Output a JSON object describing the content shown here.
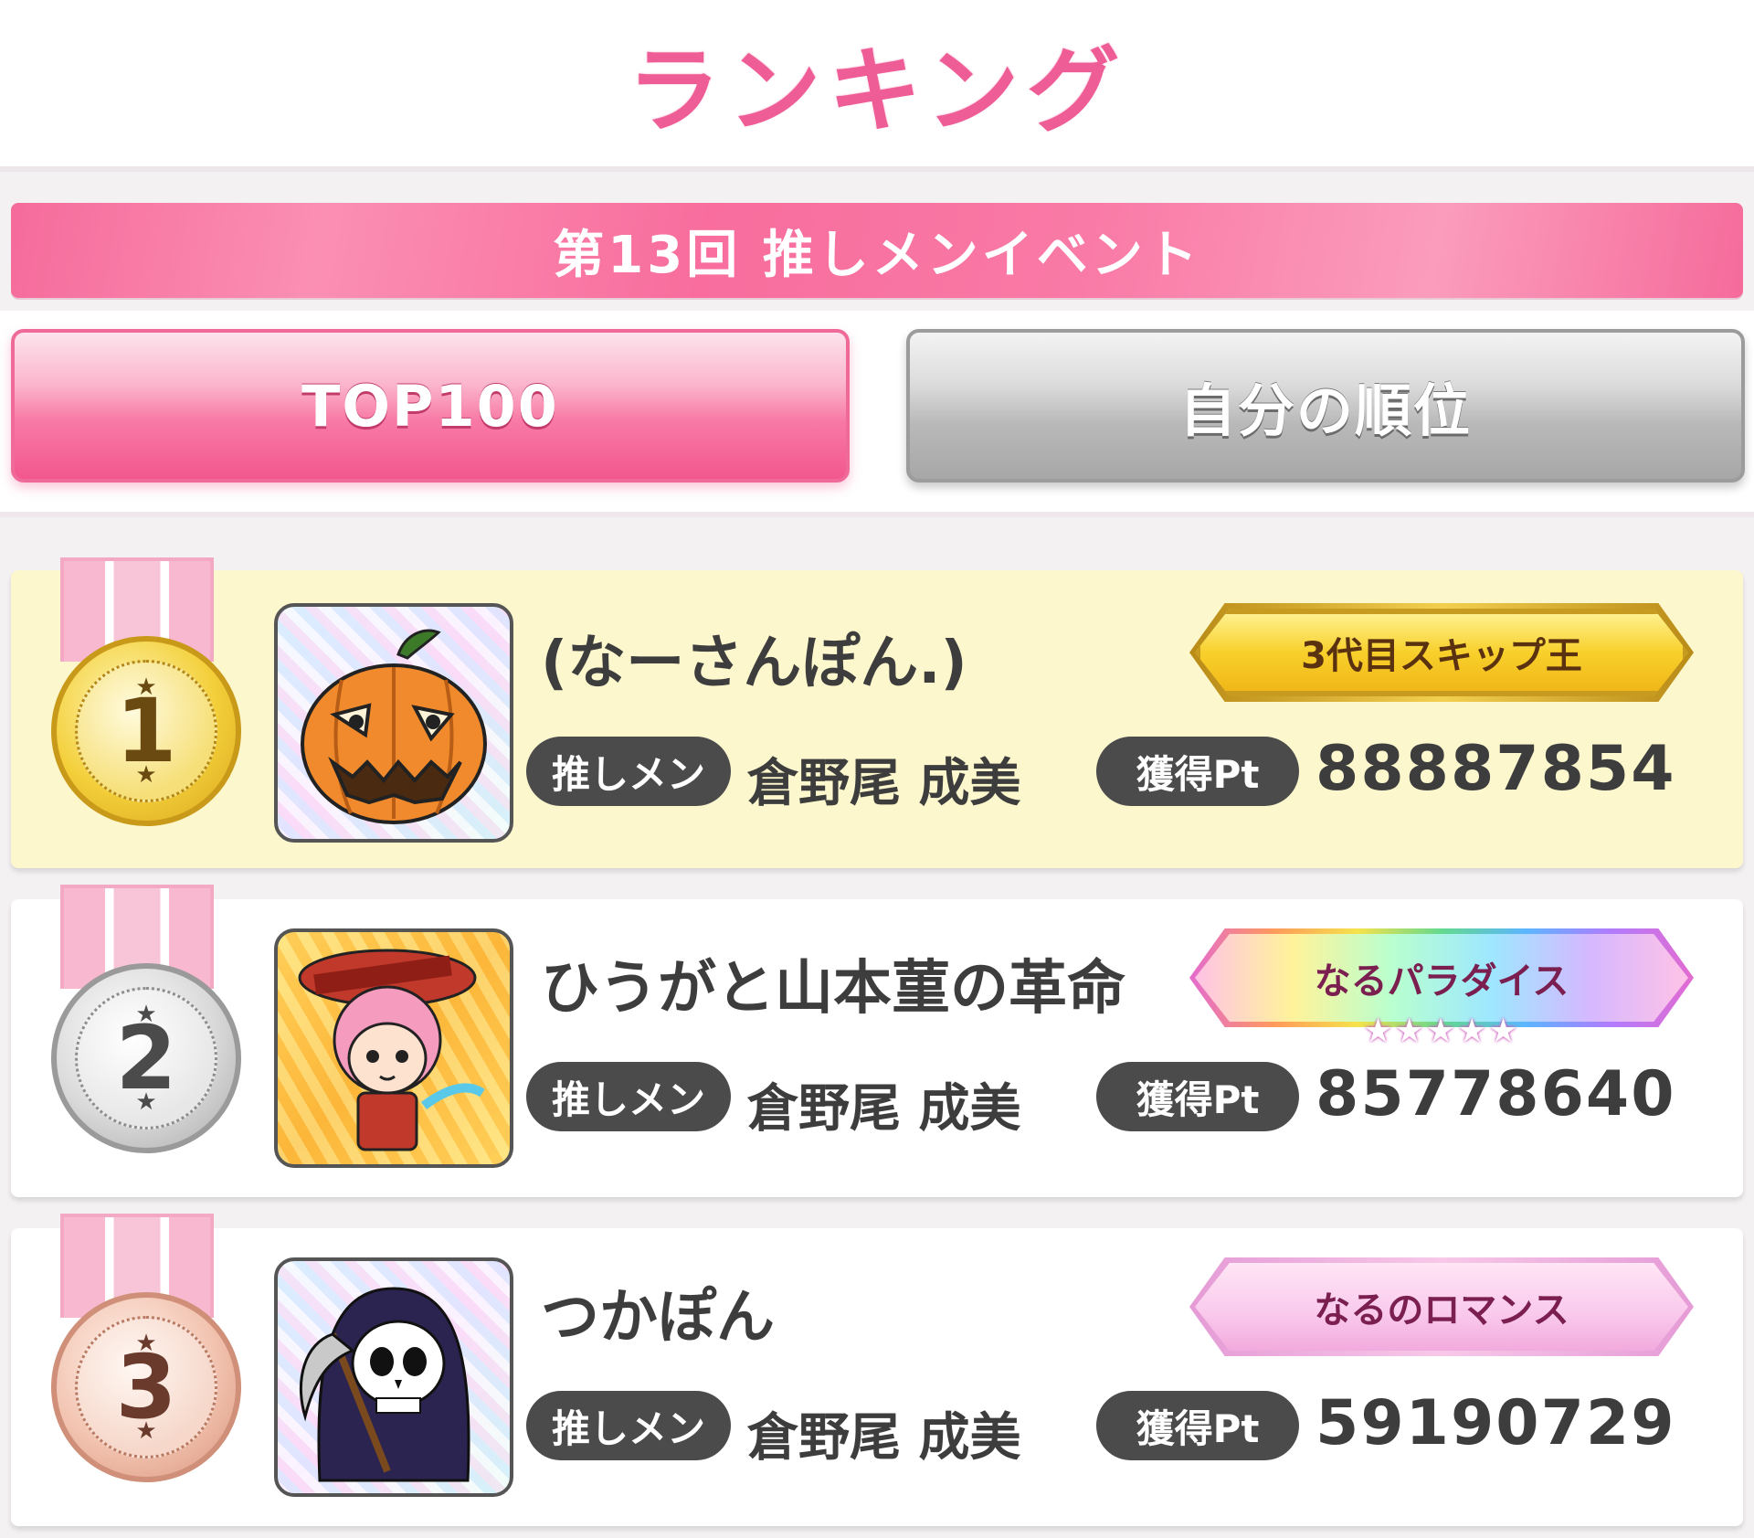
{
  "header": {
    "title": "ランキング"
  },
  "event": {
    "title": "第13回 推しメンイベント"
  },
  "tabs": [
    {
      "label": "TOP100",
      "active": true
    },
    {
      "label": "自分の順位",
      "active": false
    }
  ],
  "labels": {
    "oshi": "推しメン",
    "points": "獲得Pt"
  },
  "colors": {
    "accent": "#ef5d96",
    "pill": "#4b4b4b",
    "first_row_bg": "#fcf7cc"
  },
  "rankings": [
    {
      "rank": "1",
      "medal": "gold",
      "avatar_icon": "pumpkin-icon",
      "name": "(なーさんぽん.)",
      "badge": "3代目スキップ王",
      "badge_style": "gold",
      "oshi": "倉野尾 成美",
      "points": "88887854"
    },
    {
      "rank": "2",
      "medal": "silver",
      "avatar_icon": "anniversary-character-icon",
      "name": "ひうがと山本菫の革命",
      "badge": "なるパラダイス",
      "badge_style": "rainbow",
      "badge_stars": "★★★★★",
      "oshi": "倉野尾 成美",
      "points": "85778640"
    },
    {
      "rank": "3",
      "medal": "bronze",
      "avatar_icon": "reaper-icon",
      "name": "つかぽん",
      "badge": "なるのロマンス",
      "badge_style": "pink",
      "oshi": "倉野尾 成美",
      "points": "59190729"
    }
  ]
}
